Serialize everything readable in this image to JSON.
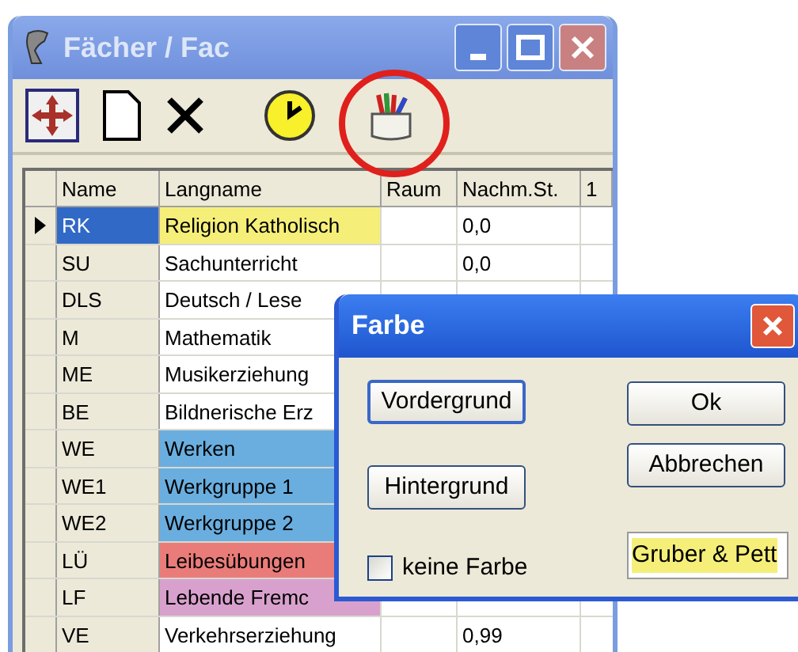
{
  "window": {
    "title": "Fächer / Fac"
  },
  "table": {
    "columns": [
      "Name",
      "Langname",
      "Raum",
      "Nachm.St.",
      "1"
    ],
    "rows": [
      {
        "name": "RK",
        "langname": "Religion Katholisch",
        "nachm": "0,0",
        "selected": true,
        "color": "#f5ef7a"
      },
      {
        "name": "SU",
        "langname": "Sachunterricht",
        "nachm": "0,0",
        "selected": false
      },
      {
        "name": "DLS",
        "langname": "Deutsch / Lese",
        "selected": false
      },
      {
        "name": "M",
        "langname": "Mathematik",
        "selected": false
      },
      {
        "name": "ME",
        "langname": "Musikerziehung",
        "selected": false
      },
      {
        "name": "BE",
        "langname": "Bildnerische Erz",
        "selected": false
      },
      {
        "name": "WE",
        "langname": "Werken",
        "selected": false,
        "color": "#6aaedf"
      },
      {
        "name": "WE1",
        "langname": "Werkgruppe 1",
        "selected": false,
        "color": "#6aaedf"
      },
      {
        "name": "WE2",
        "langname": "Werkgruppe 2",
        "selected": false,
        "color": "#6aaedf"
      },
      {
        "name": "LÜ",
        "langname": "Leibesübungen",
        "selected": false,
        "color": "#e97c79"
      },
      {
        "name": "LF",
        "langname": "Lebende Fremc",
        "selected": false,
        "color": "#d8a1cd"
      },
      {
        "name": "VE",
        "langname": "Verkehrserziehung",
        "nachm": "0,99",
        "selected": false
      }
    ]
  },
  "dialog": {
    "title": "Farbe",
    "buttons": [
      {
        "label": "Vordergrund",
        "kind": "left",
        "focused": true
      },
      {
        "label": "Hintergrund",
        "kind": "left",
        "focused": false
      },
      {
        "label": "Ok",
        "kind": "right",
        "focused": false
      },
      {
        "label": "Abbrechen",
        "kind": "right",
        "focused": false
      }
    ],
    "checkbox": {
      "label": "keine Farbe",
      "checked": false
    },
    "sample": {
      "text": "Gruber & Pett",
      "color": "#f5ef7a"
    }
  }
}
